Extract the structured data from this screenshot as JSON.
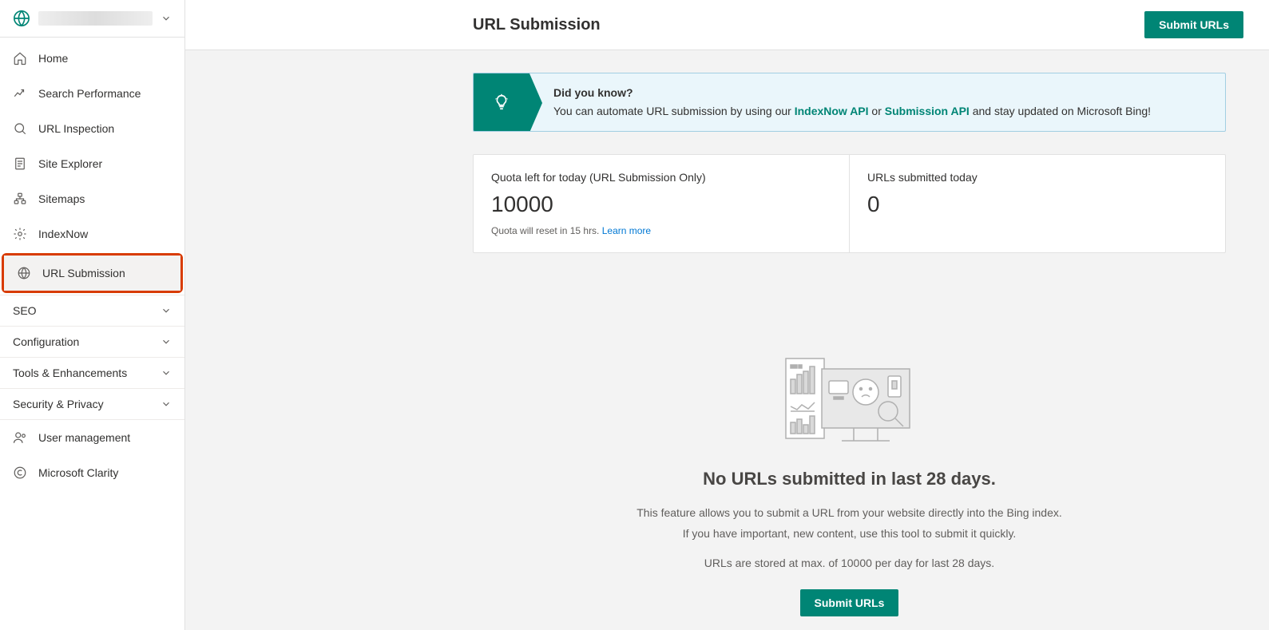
{
  "header": {
    "title": "URL Submission",
    "submit_btn": "Submit URLs"
  },
  "sidebar": {
    "items": [
      {
        "label": "Home"
      },
      {
        "label": "Search Performance"
      },
      {
        "label": "URL Inspection"
      },
      {
        "label": "Site Explorer"
      },
      {
        "label": "Sitemaps"
      },
      {
        "label": "IndexNow"
      },
      {
        "label": "URL Submission"
      }
    ],
    "sections": [
      {
        "label": "SEO"
      },
      {
        "label": "Configuration"
      },
      {
        "label": "Tools & Enhancements"
      },
      {
        "label": "Security & Privacy"
      }
    ],
    "bottom": [
      {
        "label": "User management"
      },
      {
        "label": "Microsoft Clarity"
      }
    ]
  },
  "banner": {
    "title": "Did you know?",
    "text_before": "You can automate URL submission by using our ",
    "link1": "IndexNow API",
    "text_mid": " or ",
    "link2": "Submission API",
    "text_after": " and stay updated on Microsoft Bing!"
  },
  "stats": {
    "quota_label": "Quota left for today (URL Submission Only)",
    "quota_value": "10000",
    "quota_hint": "Quota will reset in 15 hrs. ",
    "quota_learn": "Learn more",
    "submitted_label": "URLs submitted today",
    "submitted_value": "0"
  },
  "empty": {
    "heading": "No URLs submitted in last 28 days.",
    "line1": "This feature allows you to submit a URL from your website directly into the Bing index.",
    "line2": "If you have important, new content, use this tool to submit it quickly.",
    "line3": "URLs are stored at max. of 10000 per day for last 28 days.",
    "btn": "Submit URLs"
  }
}
